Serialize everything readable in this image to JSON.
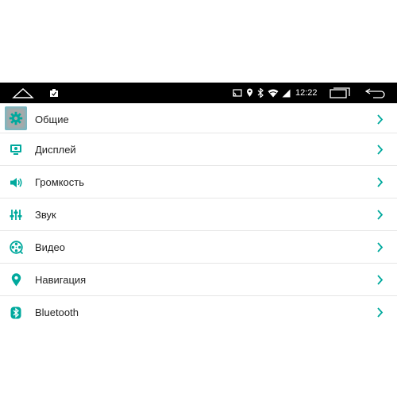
{
  "colors": {
    "accent": "#00a99d",
    "statusbar_bg": "#000000",
    "chevron": "#00a99d",
    "text": "#222222"
  },
  "statusbar": {
    "time": "12:22",
    "icons": [
      "home-icon",
      "notification-icon",
      "cast-icon",
      "location-icon",
      "bluetooth-icon",
      "wifi-icon",
      "signal-icon",
      "recent-apps-icon",
      "back-icon"
    ]
  },
  "settings": {
    "items": [
      {
        "label": "Общие",
        "icon": "gear-icon"
      },
      {
        "label": "Дисплей",
        "icon": "display-icon"
      },
      {
        "label": "Громкость",
        "icon": "volume-icon"
      },
      {
        "label": "Звук",
        "icon": "equalizer-icon"
      },
      {
        "label": "Видео",
        "icon": "video-reel-icon"
      },
      {
        "label": "Навигация",
        "icon": "location-pin-icon"
      },
      {
        "label": "Bluetooth",
        "icon": "bluetooth-icon"
      }
    ]
  }
}
